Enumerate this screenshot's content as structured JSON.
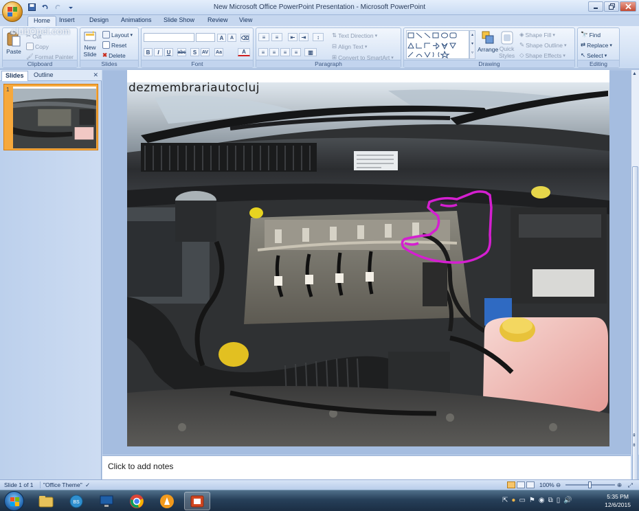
{
  "window": {
    "title": "New Microsoft Office PowerPoint Presentation - Microsoft PowerPoint"
  },
  "qat": {
    "save": "save-icon",
    "undo": "undo-icon",
    "redo": "redo-icon"
  },
  "tabs": [
    "Home",
    "Insert",
    "Design",
    "Animations",
    "Slide Show",
    "Review",
    "View"
  ],
  "watermark": "clubOpel.com",
  "ribbon": {
    "clipboard": {
      "label": "Clipboard",
      "paste": "Paste",
      "cut": "Cut",
      "copy": "Copy",
      "format_painter": "Format Painter"
    },
    "slides": {
      "label": "Slides",
      "new_slide_line1": "New",
      "new_slide_line2": "Slide",
      "layout": "Layout",
      "reset": "Reset",
      "delete": "Delete"
    },
    "font": {
      "label": "Font",
      "font_name": "",
      "font_size": ""
    },
    "paragraph": {
      "label": "Paragraph",
      "text_direction": "Text Direction",
      "align_text": "Align Text",
      "smartart": "Convert to SmartArt"
    },
    "drawing": {
      "label": "Drawing",
      "arrange": "Arrange",
      "quick_styles_line1": "Quick",
      "quick_styles_line2": "Styles",
      "shape_fill": "Shape Fill",
      "shape_outline": "Shape Outline",
      "shape_effects": "Shape Effects"
    },
    "editing": {
      "label": "Editing",
      "find": "Find",
      "replace": "Replace",
      "select": "Select"
    }
  },
  "left_pane": {
    "tab_slides": "Slides",
    "tab_outline": "Outline",
    "slide_number": "1"
  },
  "slide": {
    "caption": "dezmembrariautocluj"
  },
  "notes": {
    "placeholder": "Click to add notes"
  },
  "status": {
    "slide_info": "Slide 1 of 1",
    "theme": "\"Office Theme\"",
    "zoom": "100%"
  },
  "clock": {
    "time": "5:35 PM",
    "date": "12/6/2015"
  },
  "colors": {
    "annotation": "#d41fd0",
    "ribbon_bg": "#dce7f6",
    "selected_thumb": "#f6a83c"
  }
}
